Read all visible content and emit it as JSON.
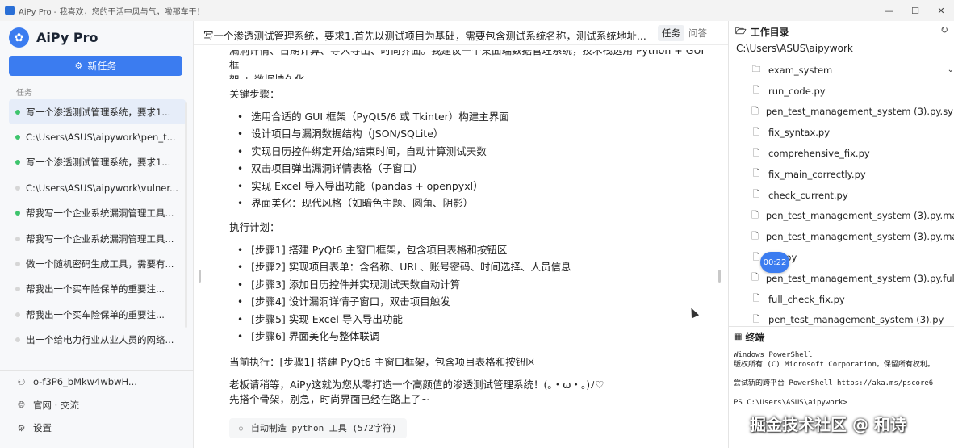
{
  "window": {
    "title": "AiPy Pro - 我喜欢，您的干活中风与气，啦那车干！",
    "minimize": "—",
    "maximize": "☐",
    "close": "✕"
  },
  "sidebar": {
    "brand": "AiPy Pro",
    "new_task": "新任务",
    "section_label": "任务",
    "tasks": [
      {
        "label": "写一个渗透测试管理系统，要求1...",
        "status_color": "#3ec46d",
        "active": true
      },
      {
        "label": "C:\\Users\\ASUS\\aipywork\\pen_t...",
        "status_color": "#3ec46d",
        "active": false
      },
      {
        "label": "写一个渗透测试管理系统，要求1...",
        "status_color": "#3ec46d",
        "active": false
      },
      {
        "label": "C:\\Users\\ASUS\\aipywork\\vulner...",
        "status_color": "#d6d6d6",
        "active": false
      },
      {
        "label": "帮我写一个企业系统漏洞管理工具...",
        "status_color": "#3ec46d",
        "active": false
      },
      {
        "label": "帮我写一个企业系统漏洞管理工具...",
        "status_color": "#d6d6d6",
        "active": false
      },
      {
        "label": "做一个随机密码生成工具，需要有...",
        "status_color": "#d6d6d6",
        "active": false
      },
      {
        "label": "帮我出一个买车险保单的重要注...",
        "status_color": "#d6d6d6",
        "active": false
      },
      {
        "label": "帮我出一个买车险保单的重要注...",
        "status_color": "#d6d6d6",
        "active": false
      },
      {
        "label": "出一个给电力行业从业人员的网络...",
        "status_color": "#d6d6d6",
        "active": false
      }
    ],
    "account": "o-f3P6_bMkw4wbwH...",
    "links": "官网 · 交流",
    "settings": "设置"
  },
  "main": {
    "title": "写一个渗透测试管理系统，要求1.首先以测试项目为基础，需要包含测试系统名称，测试系统地址...",
    "tab_task": "任务",
    "tab_qa": "问答",
    "intro_line1": "漏洞详情、日期计算、导入导出、时尚界面。我建议一个桌面端数据管理系统，技术栈选用 Python + GUI 框",
    "intro_line2": "架 + 数据持久化。",
    "steps_heading": "关键步骤：",
    "steps": [
      "选用合适的 GUI 框架（PyQt5/6 或 Tkinter）构建主界面",
      "设计项目与漏洞数据结构（JSON/SQLite）",
      "实现日历控件绑定开始/结束时间，自动计算测试天数",
      "双击项目弹出漏洞详情表格（子窗口）",
      "实现 Excel 导入导出功能（pandas + openpyxl）",
      "界面美化：现代风格（如暗色主题、圆角、阴影）"
    ],
    "plan_heading": "执行计划：",
    "plan": [
      "[步骤1] 搭建 PyQt6 主窗口框架，包含项目表格和按钮区",
      "[步骤2] 实现项目表单：含名称、URL、账号密码、时间选择、人员信息",
      "[步骤3] 添加日历控件并实现测试天数自动计算",
      "[步骤4] 设计漏洞详情子窗口，双击项目触发",
      "[步骤5] 实现 Excel 导入导出功能",
      "[步骤6] 界面美化与整体联调"
    ],
    "current": "当前执行：[步骤1] 搭建 PyQt6 主窗口框架，包含项目表格和按钮区",
    "reply_line1": "老板请稍等，AiPy这就为您从零打造一个高颜值的渗透测试管理系统！(｡・ω・｡)ﾉ♡",
    "reply_line2": "先搭个骨架，别急，时尚界面已经在路上了~",
    "tool_call": "自动制造 python 工具 (572字符)"
  },
  "workdir": {
    "title": "工作目录",
    "path": "C:\\Users\\ASUS\\aipywork",
    "files": [
      {
        "name": "exam_system",
        "icon": "folder-icon"
      },
      {
        "name": "run_code.py",
        "icon": "file-icon"
      },
      {
        "name": "pen_test_management_system (3).py.synta...",
        "icon": "file-icon"
      },
      {
        "name": "fix_syntax.py",
        "icon": "file-icon"
      },
      {
        "name": "comprehensive_fix.py",
        "icon": "file-icon"
      },
      {
        "name": "fix_main_correctly.py",
        "icon": "file-icon"
      },
      {
        "name": "check_current.py",
        "icon": "file-icon"
      },
      {
        "name": "pen_test_management_system (3).py.main...",
        "icon": "file-icon"
      },
      {
        "name": "pen_test_management_system (3).py.main...",
        "icon": "file-icon"
      },
      {
        "name": "ain.py",
        "icon": "file-icon"
      },
      {
        "name": "pen_test_management_system (3).py.full_b...",
        "icon": "file-icon"
      },
      {
        "name": "full_check_fix.py",
        "icon": "file-icon"
      },
      {
        "name": "pen_test_management_system (3).py",
        "icon": "file-icon"
      }
    ],
    "recording_time": "00:22"
  },
  "terminal": {
    "title": "终端",
    "lines": [
      "Windows PowerShell",
      "版权所有 (C) Microsoft Corporation。保留所有权利。",
      "",
      "尝试新的跨平台 PowerShell https://aka.ms/pscore6",
      "",
      "PS C:\\Users\\ASUS\\aipywork>"
    ]
  },
  "watermark": "掘金技术社区 @ 和诗",
  "colors": {
    "accent": "#3b7cf0",
    "status_done": "#3ec46d",
    "status_idle": "#d6d6d6"
  }
}
